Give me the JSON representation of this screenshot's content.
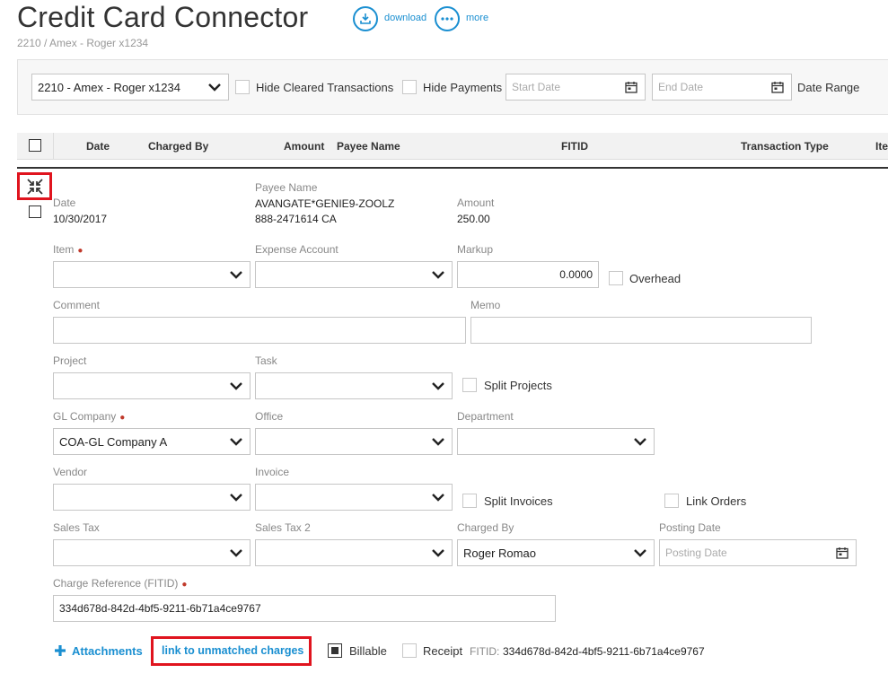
{
  "header": {
    "title": "Credit Card Connector",
    "subtitle": "2210 / Amex - Roger x1234",
    "download_label": "download",
    "more_label": "more"
  },
  "filters": {
    "account_select": "2210 - Amex - Roger x1234",
    "hide_cleared_label": "Hide Cleared Transactions",
    "hide_payments_label": "Hide Payments",
    "start_date_placeholder": "Start Date",
    "end_date_placeholder": "End Date",
    "date_range_label": "Date Range"
  },
  "table": {
    "columns": [
      "Date",
      "Charged By",
      "Amount",
      "Payee Name",
      "FITID",
      "Transaction Type",
      "Ite"
    ]
  },
  "detail": {
    "date_label": "Date",
    "date_value": "10/30/2017",
    "payee_label": "Payee Name",
    "payee_line1": "AVANGATE*GENIE9-ZOOLZ",
    "payee_line2": "888-2471614 CA",
    "amount_label": "Amount",
    "amount_value": "250.00",
    "item_label": "Item",
    "expense_account_label": "Expense Account",
    "markup_label": "Markup",
    "markup_value": "0.0000",
    "overhead_label": "Overhead",
    "comment_label": "Comment",
    "memo_label": "Memo",
    "project_label": "Project",
    "task_label": "Task",
    "split_projects_label": "Split Projects",
    "gl_company_label": "GL Company",
    "gl_company_value": "COA-GL Company A",
    "office_label": "Office",
    "department_label": "Department",
    "vendor_label": "Vendor",
    "invoice_label": "Invoice",
    "split_invoices_label": "Split Invoices",
    "link_orders_label": "Link Orders",
    "sales_tax_label": "Sales Tax",
    "sales_tax2_label": "Sales Tax 2",
    "charged_by_label": "Charged By",
    "charged_by_value": "Roger Romao",
    "posting_date_label": "Posting Date",
    "posting_date_placeholder": "Posting Date",
    "charge_ref_label": "Charge Reference (FITID)",
    "charge_ref_value": "334d678d-842d-4bf5-9211-6b71a4ce9767",
    "required_mark": "●"
  },
  "footer": {
    "attachments_label": "Attachments",
    "link_unmatched_label": "link to unmatched charges",
    "billable_label": "Billable",
    "receipt_label": "Receipt",
    "fitid_label": "FITID:",
    "fitid_value": "334d678d-842d-4bf5-9211-6b71a4ce9767"
  },
  "icons": {
    "download": "download-icon",
    "more": "more-icon",
    "collapse": "collapse-icon",
    "chevron": "chevron-down-icon",
    "calendar": "calendar-icon",
    "plus": "plus-icon"
  },
  "colors": {
    "accent": "#1a8fd1",
    "highlight": "#e0141e",
    "required": "#c0392b"
  }
}
